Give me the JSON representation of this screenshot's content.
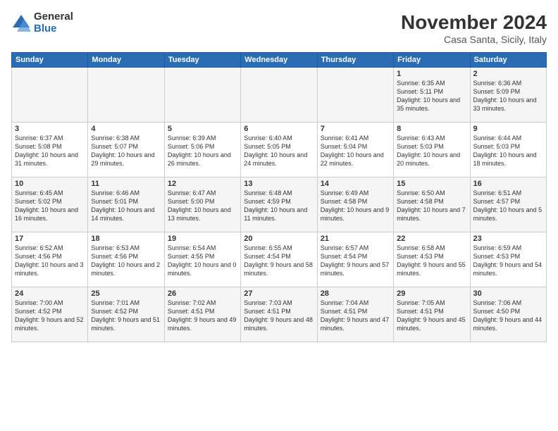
{
  "logo": {
    "general": "General",
    "blue": "Blue"
  },
  "title": "November 2024",
  "subtitle": "Casa Santa, Sicily, Italy",
  "days_header": [
    "Sunday",
    "Monday",
    "Tuesday",
    "Wednesday",
    "Thursday",
    "Friday",
    "Saturday"
  ],
  "weeks": [
    [
      {
        "day": "",
        "info": ""
      },
      {
        "day": "",
        "info": ""
      },
      {
        "day": "",
        "info": ""
      },
      {
        "day": "",
        "info": ""
      },
      {
        "day": "",
        "info": ""
      },
      {
        "day": "1",
        "info": "Sunrise: 6:35 AM\nSunset: 5:11 PM\nDaylight: 10 hours and 35 minutes."
      },
      {
        "day": "2",
        "info": "Sunrise: 6:36 AM\nSunset: 5:09 PM\nDaylight: 10 hours and 33 minutes."
      }
    ],
    [
      {
        "day": "3",
        "info": "Sunrise: 6:37 AM\nSunset: 5:08 PM\nDaylight: 10 hours and 31 minutes."
      },
      {
        "day": "4",
        "info": "Sunrise: 6:38 AM\nSunset: 5:07 PM\nDaylight: 10 hours and 29 minutes."
      },
      {
        "day": "5",
        "info": "Sunrise: 6:39 AM\nSunset: 5:06 PM\nDaylight: 10 hours and 26 minutes."
      },
      {
        "day": "6",
        "info": "Sunrise: 6:40 AM\nSunset: 5:05 PM\nDaylight: 10 hours and 24 minutes."
      },
      {
        "day": "7",
        "info": "Sunrise: 6:41 AM\nSunset: 5:04 PM\nDaylight: 10 hours and 22 minutes."
      },
      {
        "day": "8",
        "info": "Sunrise: 6:43 AM\nSunset: 5:03 PM\nDaylight: 10 hours and 20 minutes."
      },
      {
        "day": "9",
        "info": "Sunrise: 6:44 AM\nSunset: 5:03 PM\nDaylight: 10 hours and 18 minutes."
      }
    ],
    [
      {
        "day": "10",
        "info": "Sunrise: 6:45 AM\nSunset: 5:02 PM\nDaylight: 10 hours and 16 minutes."
      },
      {
        "day": "11",
        "info": "Sunrise: 6:46 AM\nSunset: 5:01 PM\nDaylight: 10 hours and 14 minutes."
      },
      {
        "day": "12",
        "info": "Sunrise: 6:47 AM\nSunset: 5:00 PM\nDaylight: 10 hours and 13 minutes."
      },
      {
        "day": "13",
        "info": "Sunrise: 6:48 AM\nSunset: 4:59 PM\nDaylight: 10 hours and 11 minutes."
      },
      {
        "day": "14",
        "info": "Sunrise: 6:49 AM\nSunset: 4:58 PM\nDaylight: 10 hours and 9 minutes."
      },
      {
        "day": "15",
        "info": "Sunrise: 6:50 AM\nSunset: 4:58 PM\nDaylight: 10 hours and 7 minutes."
      },
      {
        "day": "16",
        "info": "Sunrise: 6:51 AM\nSunset: 4:57 PM\nDaylight: 10 hours and 5 minutes."
      }
    ],
    [
      {
        "day": "17",
        "info": "Sunrise: 6:52 AM\nSunset: 4:56 PM\nDaylight: 10 hours and 3 minutes."
      },
      {
        "day": "18",
        "info": "Sunrise: 6:53 AM\nSunset: 4:56 PM\nDaylight: 10 hours and 2 minutes."
      },
      {
        "day": "19",
        "info": "Sunrise: 6:54 AM\nSunset: 4:55 PM\nDaylight: 10 hours and 0 minutes."
      },
      {
        "day": "20",
        "info": "Sunrise: 6:55 AM\nSunset: 4:54 PM\nDaylight: 9 hours and 58 minutes."
      },
      {
        "day": "21",
        "info": "Sunrise: 6:57 AM\nSunset: 4:54 PM\nDaylight: 9 hours and 57 minutes."
      },
      {
        "day": "22",
        "info": "Sunrise: 6:58 AM\nSunset: 4:53 PM\nDaylight: 9 hours and 55 minutes."
      },
      {
        "day": "23",
        "info": "Sunrise: 6:59 AM\nSunset: 4:53 PM\nDaylight: 9 hours and 54 minutes."
      }
    ],
    [
      {
        "day": "24",
        "info": "Sunrise: 7:00 AM\nSunset: 4:52 PM\nDaylight: 9 hours and 52 minutes."
      },
      {
        "day": "25",
        "info": "Sunrise: 7:01 AM\nSunset: 4:52 PM\nDaylight: 9 hours and 51 minutes."
      },
      {
        "day": "26",
        "info": "Sunrise: 7:02 AM\nSunset: 4:51 PM\nDaylight: 9 hours and 49 minutes."
      },
      {
        "day": "27",
        "info": "Sunrise: 7:03 AM\nSunset: 4:51 PM\nDaylight: 9 hours and 48 minutes."
      },
      {
        "day": "28",
        "info": "Sunrise: 7:04 AM\nSunset: 4:51 PM\nDaylight: 9 hours and 47 minutes."
      },
      {
        "day": "29",
        "info": "Sunrise: 7:05 AM\nSunset: 4:51 PM\nDaylight: 9 hours and 45 minutes."
      },
      {
        "day": "30",
        "info": "Sunrise: 7:06 AM\nSunset: 4:50 PM\nDaylight: 9 hours and 44 minutes."
      }
    ]
  ]
}
